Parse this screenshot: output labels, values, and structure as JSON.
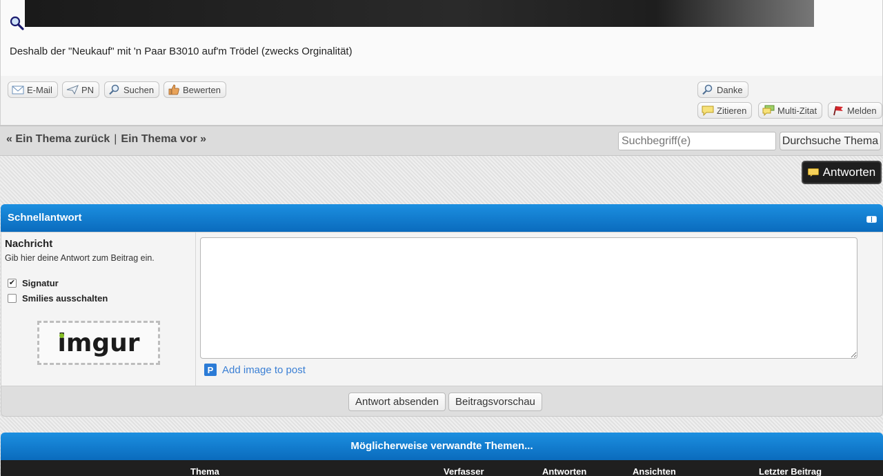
{
  "post": {
    "text": "Deshalb der \"Neukauf\" mit 'n Paar B3010 auf'm Trödel (zwecks Orginalität)"
  },
  "post_buttons": {
    "email": "E-Mail",
    "pn": "PN",
    "search": "Suchen",
    "rate": "Bewerten",
    "thanks": "Danke",
    "quote": "Zitieren",
    "multi_quote": "Multi-Zitat",
    "report": "Melden"
  },
  "thread_nav": {
    "prev": "« Ein Thema zurück",
    "sep": "|",
    "next": "Ein Thema vor »",
    "search_placeholder": "Suchbegriff(e)",
    "search_button": "Durchsuche Thema"
  },
  "reply_button": "Antworten",
  "quick_reply": {
    "title": "Schnellantwort",
    "label": "Nachricht",
    "description": "Gib hier deine Antwort zum Beitrag ein.",
    "options": [
      {
        "label": "Signatur",
        "checked": true
      },
      {
        "label": "Smilies ausschalten",
        "checked": false
      }
    ],
    "imgur_logo": "imgur",
    "add_image": "Add image to post",
    "submit": "Antwort absenden",
    "preview": "Beitragsvorschau"
  },
  "related": {
    "title": "Möglicherweise verwandte Themen...",
    "columns": [
      "Thema",
      "Verfasser",
      "Antworten",
      "Ansichten",
      "Letzter Beitrag"
    ]
  },
  "colors": {
    "header_blue": "#0a6bbd",
    "link_blue": "#3a7fd4",
    "dark_button": "#1e1e1e"
  }
}
